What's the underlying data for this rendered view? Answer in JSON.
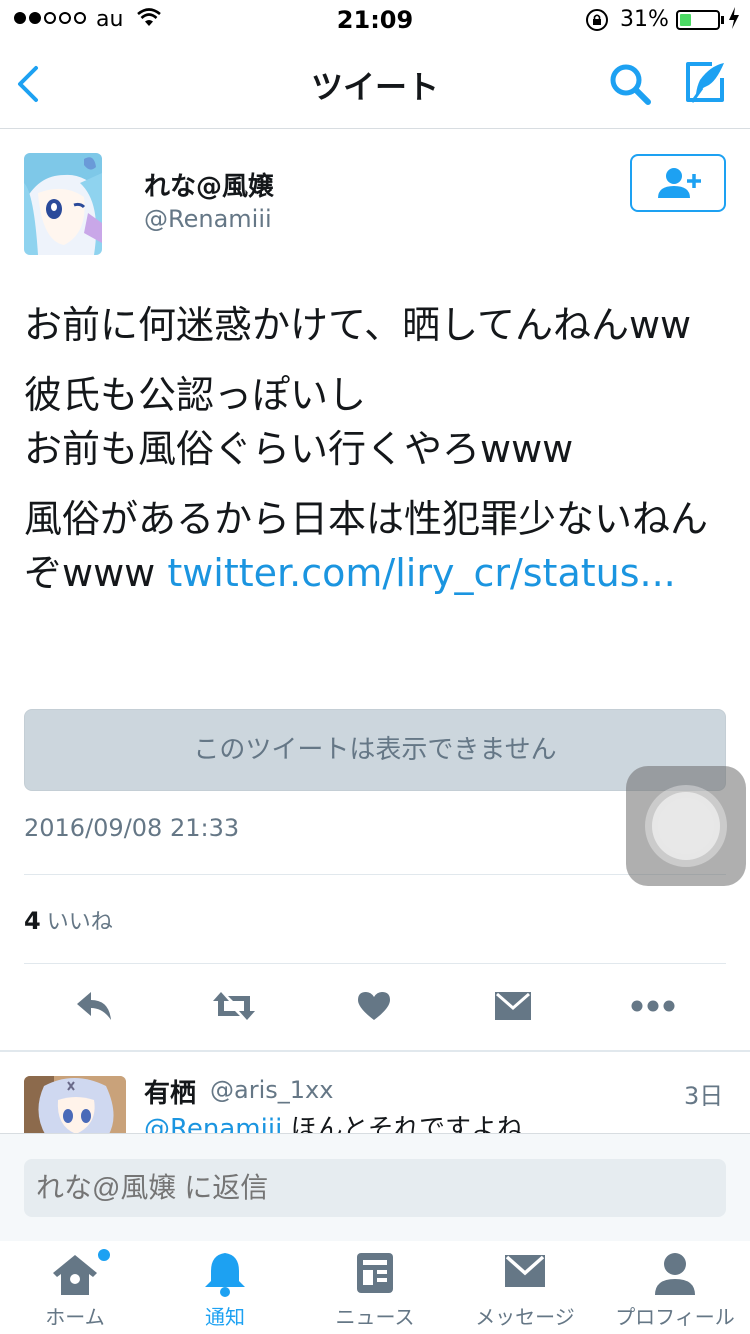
{
  "status_bar": {
    "carrier": "au",
    "time": "21:09",
    "battery_percent": "31%",
    "battery_level": 0.31
  },
  "nav": {
    "title": "ツイート",
    "back_icon": "chevron-left-icon",
    "search_icon": "search-icon",
    "compose_icon": "compose-icon"
  },
  "tweet": {
    "author_name": "れな@風嬢",
    "author_handle": "@Renamiii",
    "paragraphs": [
      "お前に何迷惑かけて、晒してんねんww",
      "彼氏も公認っぽいし\nお前も風俗ぐらい行くやろwww",
      "風俗があるから日本は性犯罪少ないねんぞwww "
    ],
    "link": "twitter.com/liry_cr/status...",
    "unavailable_text": "このツイートは表示できません",
    "timestamp": "2016/09/08 21:33",
    "likes_count": "4",
    "likes_label": "いいね"
  },
  "actions": [
    "reply-icon",
    "retweet-icon",
    "like-icon",
    "message-icon",
    "more-icon"
  ],
  "reply": {
    "name": "有栖",
    "handle": "@aris_1xx",
    "time": "3日",
    "mention": "@Renamiii",
    "text": " ほんとそれですよね"
  },
  "composer": {
    "placeholder": "れな@風嬢 に返信"
  },
  "tabs": [
    {
      "label": "ホーム",
      "icon": "home-icon"
    },
    {
      "label": "通知",
      "icon": "bell-icon"
    },
    {
      "label": "ニュース",
      "icon": "news-icon"
    },
    {
      "label": "メッセージ",
      "icon": "envelope-icon"
    },
    {
      "label": "プロフィール",
      "icon": "profile-icon"
    }
  ],
  "colors": {
    "accent": "#1da1f2",
    "link": "#1b95e0",
    "muted": "#657786",
    "icon_gray": "#657786",
    "battery": "#4cd964"
  }
}
